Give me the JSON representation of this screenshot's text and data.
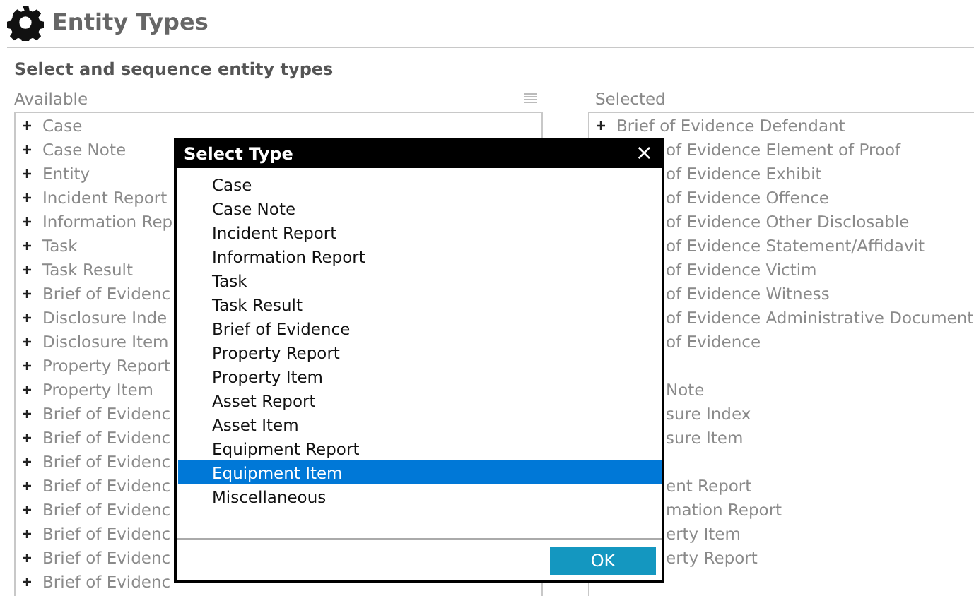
{
  "header": {
    "title": "Entity Types"
  },
  "subtitle": "Select and sequence entity types",
  "available": {
    "label": "Available",
    "items": [
      {
        "kind": "full",
        "text": "Case"
      },
      {
        "kind": "full",
        "text": "Case Note"
      },
      {
        "kind": "full",
        "text": "Entity"
      },
      {
        "kind": "full",
        "text": "Incident Report"
      },
      {
        "kind": "full",
        "text": "Information Rep"
      },
      {
        "kind": "full",
        "text": "Task"
      },
      {
        "kind": "full",
        "text": "Task Result"
      },
      {
        "kind": "full",
        "text": "Brief of Evidenc"
      },
      {
        "kind": "full",
        "text": "Disclosure Inde"
      },
      {
        "kind": "full",
        "text": "Disclosure Item"
      },
      {
        "kind": "full",
        "text": "Property Report"
      },
      {
        "kind": "full",
        "text": "Property Item"
      },
      {
        "kind": "full",
        "text": "Brief of Evidenc"
      },
      {
        "kind": "full",
        "text": "Brief of Evidenc"
      },
      {
        "kind": "full",
        "text": "Brief of Evidenc"
      },
      {
        "kind": "full",
        "text": "Brief of Evidenc"
      },
      {
        "kind": "full",
        "text": "Brief of Evidenc"
      },
      {
        "kind": "full",
        "text": "Brief of Evidenc"
      },
      {
        "kind": "full",
        "text": "Brief of Evidenc"
      },
      {
        "kind": "full",
        "text": "Brief of Evidenc"
      }
    ]
  },
  "selected": {
    "label": "Selected",
    "items": [
      {
        "kind": "full",
        "text": "Brief of Evidence Defendant"
      },
      {
        "kind": "clipped",
        "text": "of Evidence Element of Proof"
      },
      {
        "kind": "clipped",
        "text": "of Evidence Exhibit"
      },
      {
        "kind": "clipped",
        "text": "of Evidence Offence"
      },
      {
        "kind": "clipped",
        "text": "of Evidence Other Disclosable"
      },
      {
        "kind": "clipped",
        "text": "of Evidence Statement/Affidavit"
      },
      {
        "kind": "clipped",
        "text": "of Evidence Victim"
      },
      {
        "kind": "clipped",
        "text": "of Evidence Witness"
      },
      {
        "kind": "clipped",
        "text": "of Evidence Administrative Document"
      },
      {
        "kind": "clipped",
        "text": "of Evidence"
      },
      {
        "kind": "hidden"
      },
      {
        "kind": "clipped",
        "text": "Note"
      },
      {
        "kind": "clipped",
        "text": "sure Index"
      },
      {
        "kind": "clipped",
        "text": "sure Item"
      },
      {
        "kind": "hidden"
      },
      {
        "kind": "clipped",
        "text": "ent Report"
      },
      {
        "kind": "clipped",
        "text": "mation Report"
      },
      {
        "kind": "clipped",
        "text": "erty Item"
      },
      {
        "kind": "clipped",
        "text": "erty Report"
      }
    ]
  },
  "dialog": {
    "title": "Select Type",
    "close": "×",
    "items": [
      {
        "text": "Case",
        "selected": false
      },
      {
        "text": "Case Note",
        "selected": false
      },
      {
        "text": "Incident Report",
        "selected": false
      },
      {
        "text": "Information Report",
        "selected": false
      },
      {
        "text": "Task",
        "selected": false
      },
      {
        "text": "Task Result",
        "selected": false
      },
      {
        "text": "Brief of Evidence",
        "selected": false
      },
      {
        "text": "Property Report",
        "selected": false
      },
      {
        "text": "Property Item",
        "selected": false
      },
      {
        "text": "Asset Report",
        "selected": false
      },
      {
        "text": "Asset Item",
        "selected": false
      },
      {
        "text": "Equipment Report",
        "selected": false
      },
      {
        "text": "Equipment Item",
        "selected": true
      },
      {
        "text": "Miscellaneous",
        "selected": false
      }
    ],
    "ok": "OK"
  }
}
